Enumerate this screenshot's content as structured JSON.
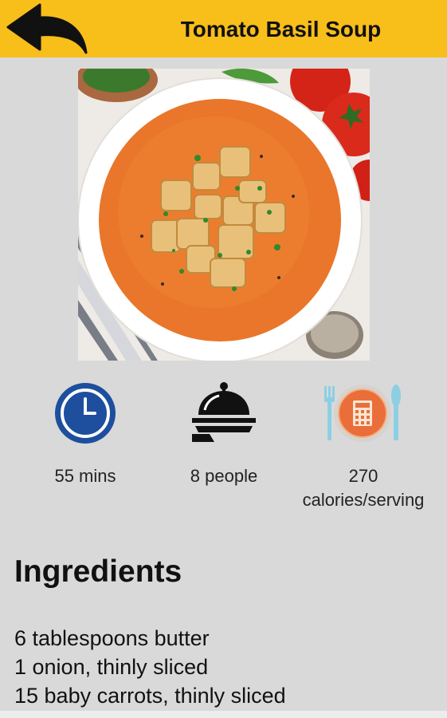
{
  "header": {
    "title": "Tomato Basil Soup",
    "back_icon": "back-arrow-icon",
    "background_color": "#f8be1a"
  },
  "recipe_image": {
    "alt": "Tomato Basil Soup"
  },
  "stats": [
    {
      "icon": "clock-icon",
      "label": "55 mins"
    },
    {
      "icon": "serving-cloche-icon",
      "label": "8 people"
    },
    {
      "icon": "calculator-plate-icon",
      "label": "270\ncalories/serving"
    }
  ],
  "ingredients": {
    "heading": "Ingredients",
    "items": [
      "6 tablespoons butter",
      "1 onion, thinly sliced",
      "15 baby carrots, thinly sliced"
    ]
  }
}
